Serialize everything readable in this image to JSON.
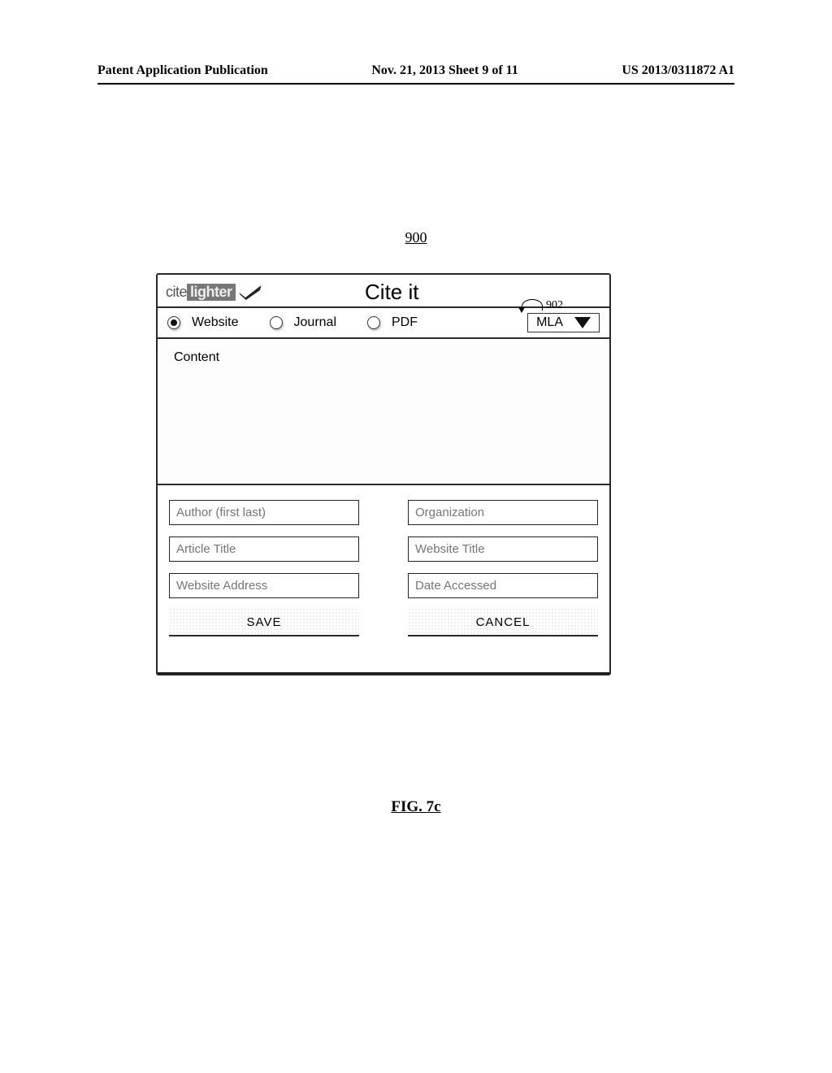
{
  "header": {
    "left": "Patent Application Publication",
    "center": "Nov. 21, 2013  Sheet 9 of 11",
    "right": "US 2013/0311872 A1"
  },
  "figure_ref": "900",
  "callout_ref": "902",
  "logo": {
    "part1": "cite",
    "part2": "lighter"
  },
  "title": "Cite it",
  "source_types": {
    "options": [
      {
        "label": "Website",
        "checked": true
      },
      {
        "label": "Journal",
        "checked": false
      },
      {
        "label": "PDF",
        "checked": false
      }
    ]
  },
  "style_select": {
    "value": "MLA"
  },
  "content_label": "Content",
  "fields": {
    "author": "Author (first last)",
    "organization": "Organization",
    "article_title": "Article Title",
    "website_title": "Website Title",
    "website_address": "Website Address",
    "date_accessed": "Date Accessed"
  },
  "actions": {
    "save": "SAVE",
    "cancel": "CANCEL"
  },
  "caption": "FIG. 7c"
}
